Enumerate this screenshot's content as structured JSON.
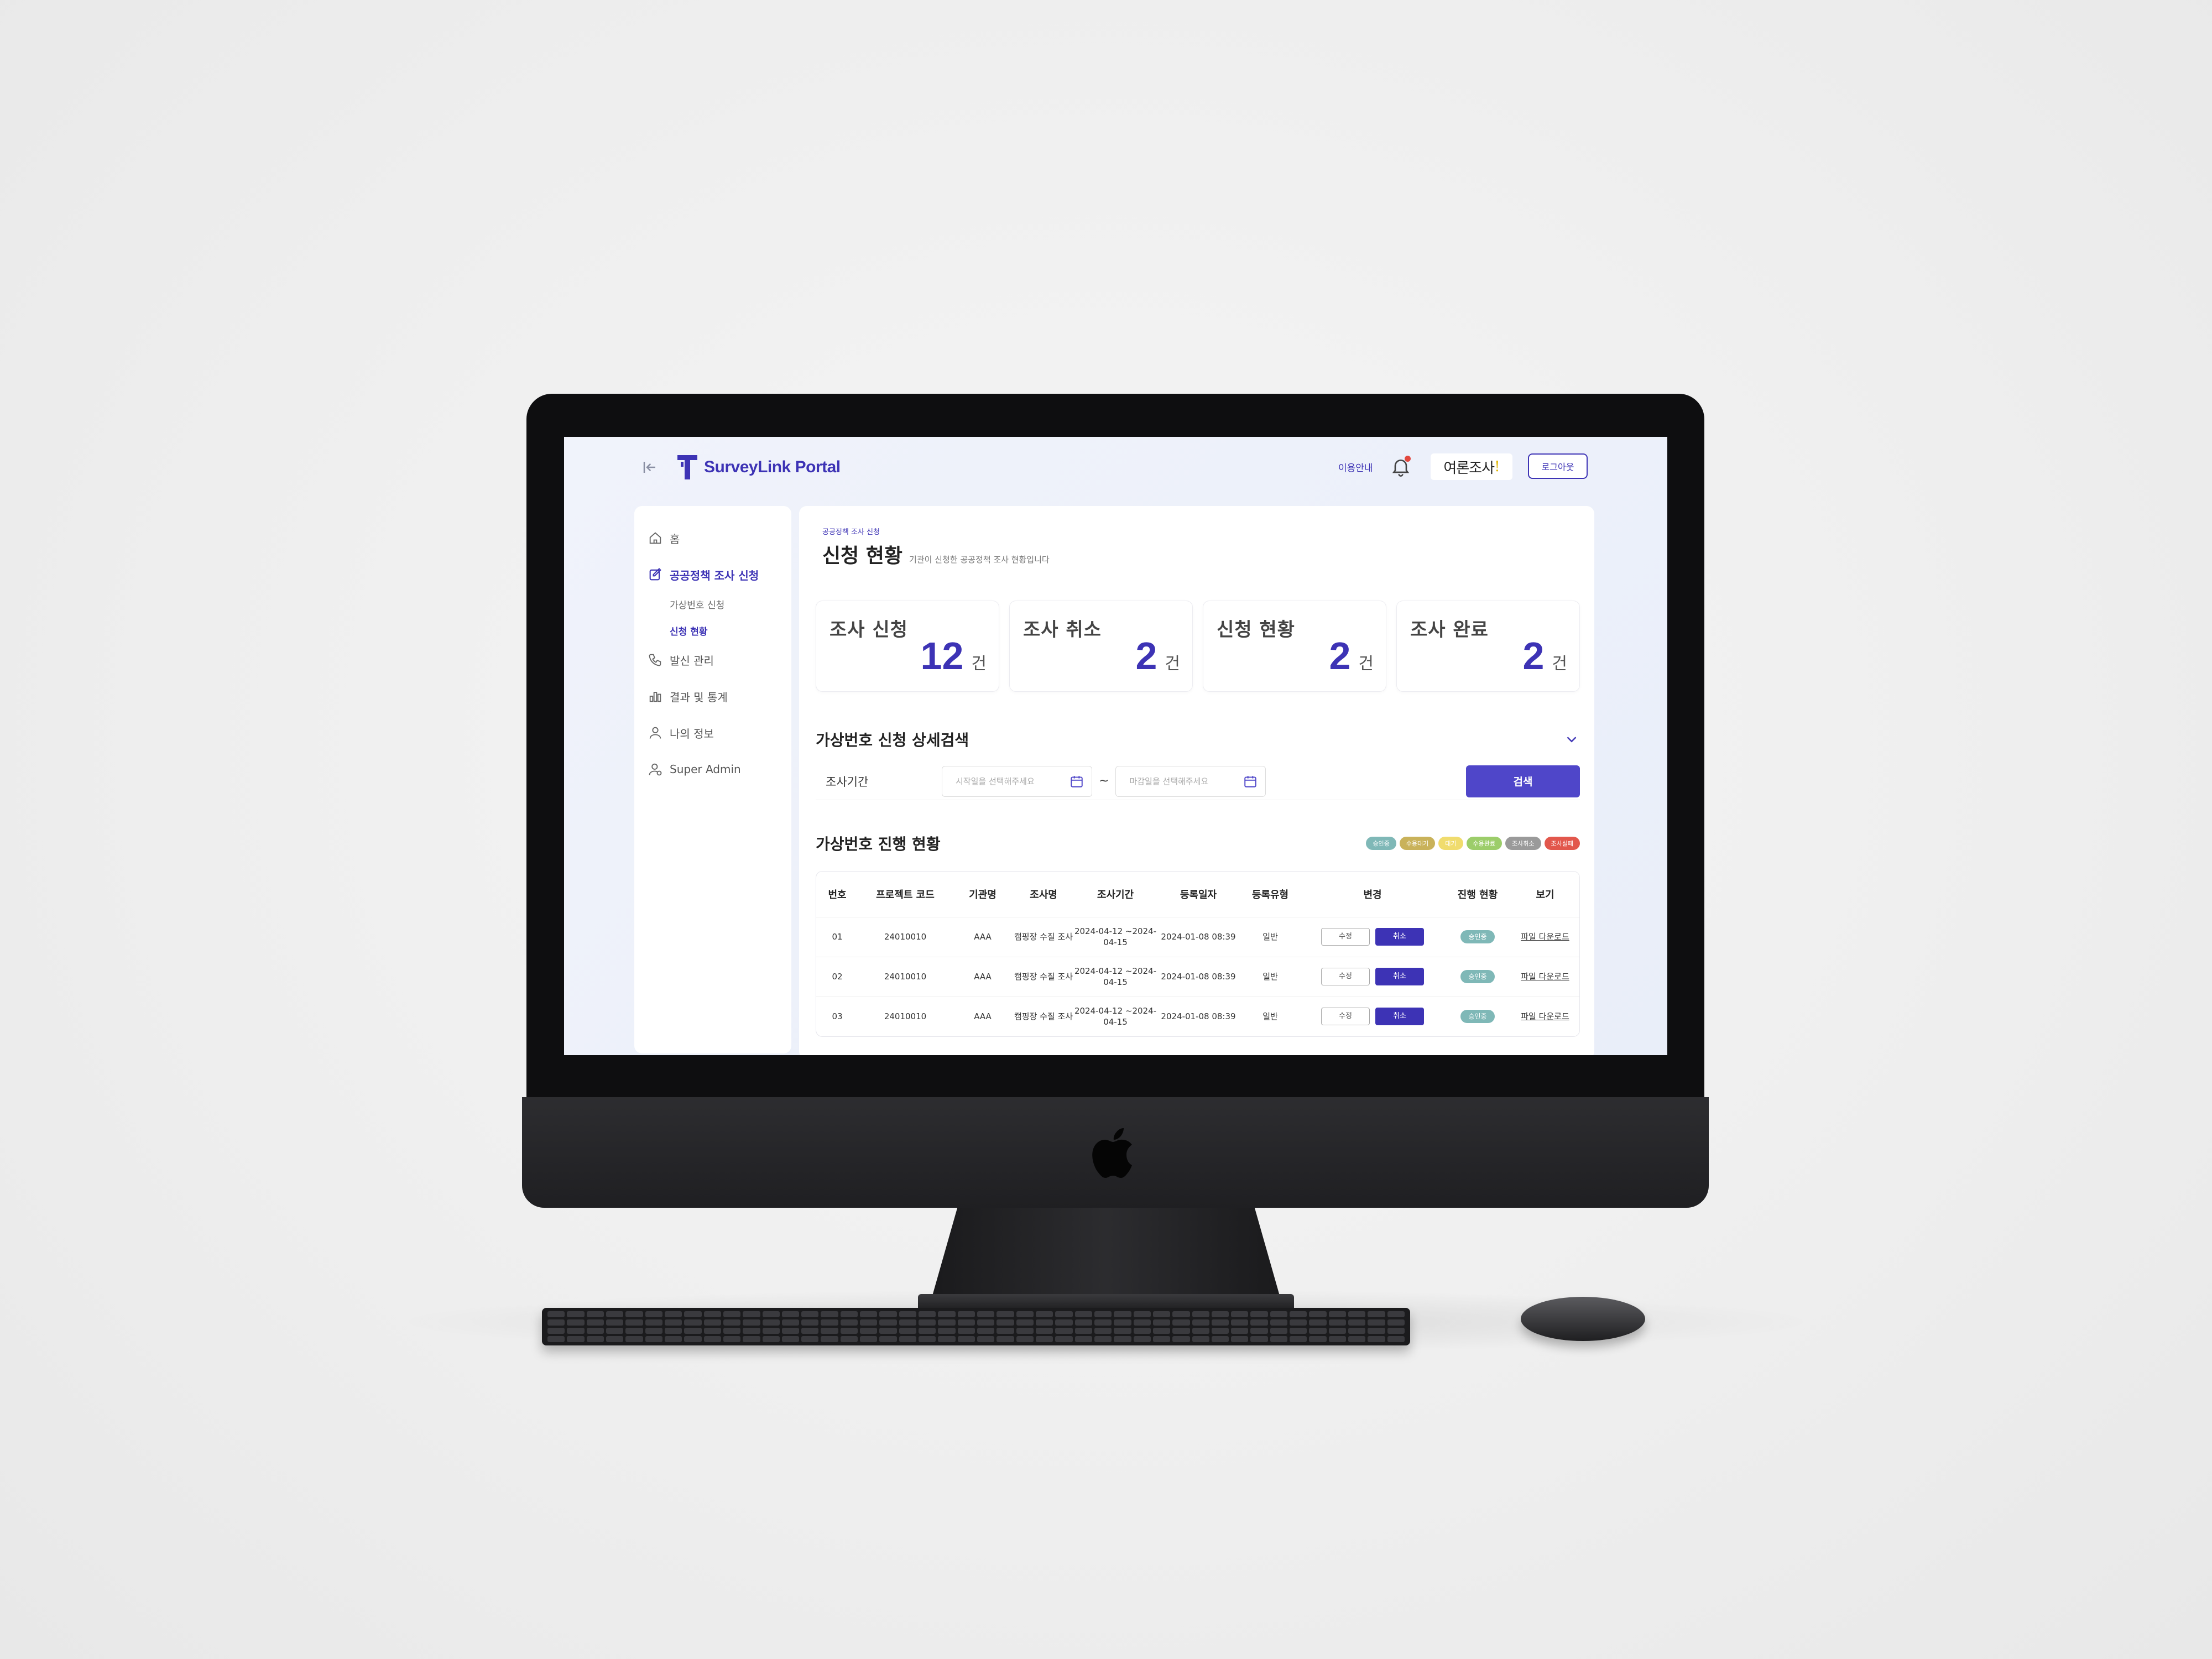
{
  "header": {
    "brand_name": "SurveyLink Portal",
    "guide_label": "이용안내",
    "org_logo_text": "여론조사",
    "logout_label": "로그아웃"
  },
  "sidebar": {
    "items": [
      {
        "label": "홈",
        "icon": "home-icon"
      },
      {
        "label": "공공정책 조사 신청",
        "icon": "edit-icon",
        "active": true
      },
      {
        "label": "발신 관리",
        "icon": "phone-icon"
      },
      {
        "label": "결과 및 통계",
        "icon": "chart-icon"
      },
      {
        "label": "나의 정보",
        "icon": "user-icon"
      },
      {
        "label": "Super Admin",
        "icon": "admin-icon"
      }
    ],
    "sub_items": [
      {
        "label": "가상번호 신청"
      },
      {
        "label": "신청 현황",
        "active": true
      }
    ]
  },
  "main": {
    "breadcrumb": "공공정책 조사 신청",
    "title": "신청 현황",
    "description": "기관이 신청한 공공정책 조사 현황입니다",
    "stats": [
      {
        "label": "조사 신청",
        "value": "12",
        "unit": "건"
      },
      {
        "label": "조사 취소",
        "value": "2",
        "unit": "건"
      },
      {
        "label": "신청 현황",
        "value": "2",
        "unit": "건"
      },
      {
        "label": "조사 완료",
        "value": "2",
        "unit": "건"
      }
    ],
    "search": {
      "title": "가상번호 신청 상세검색",
      "period_label": "조사기간",
      "start_placeholder": "시작일을 선택해주세요",
      "end_placeholder": "마감일을 선택해주세요",
      "separator": "~",
      "button_label": "검색"
    },
    "progress": {
      "title": "가상번호 진행 현황",
      "legend": [
        {
          "label": "승인중",
          "color": "#7fb8b7"
        },
        {
          "label": "수용대기",
          "color": "#c9b25a"
        },
        {
          "label": "대기",
          "color": "#f0dc6e"
        },
        {
          "label": "수용완료",
          "color": "#9ccd6a"
        },
        {
          "label": "조사취소",
          "color": "#9a9a9a"
        },
        {
          "label": "조사실패",
          "color": "#e2574c"
        }
      ],
      "columns": [
        "번호",
        "프로젝트 코드",
        "기관명",
        "조사명",
        "조사기간",
        "등록일자",
        "등록유형",
        "변경",
        "진행 현황",
        "보기"
      ],
      "rows": [
        {
          "no": "01",
          "code": "24010010",
          "org": "AAA",
          "name": "캠핑장 수질 조사",
          "period": "2024-04-12 ~2024-04-15",
          "date": "2024-01-08 08:39",
          "type": "일반",
          "edit": "수정",
          "cancel": "취소",
          "status": "승인중",
          "view": "파일 다운로드"
        },
        {
          "no": "02",
          "code": "24010010",
          "org": "AAA",
          "name": "캠핑장 수질 조사",
          "period": "2024-04-12 ~2024-04-15",
          "date": "2024-01-08 08:39",
          "type": "일반",
          "edit": "수정",
          "cancel": "취소",
          "status": "승인중",
          "view": "파일 다운로드"
        },
        {
          "no": "03",
          "code": "24010010",
          "org": "AAA",
          "name": "캠핑장 수질 조사",
          "period": "2024-04-12 ~2024-04-15",
          "date": "2024-01-08 08:39",
          "type": "일반",
          "edit": "수정",
          "cancel": "취소",
          "status": "승인중",
          "view": "파일 다운로드"
        }
      ]
    }
  },
  "colors": {
    "accent": "#3d33b5",
    "button": "#4f46c9"
  }
}
